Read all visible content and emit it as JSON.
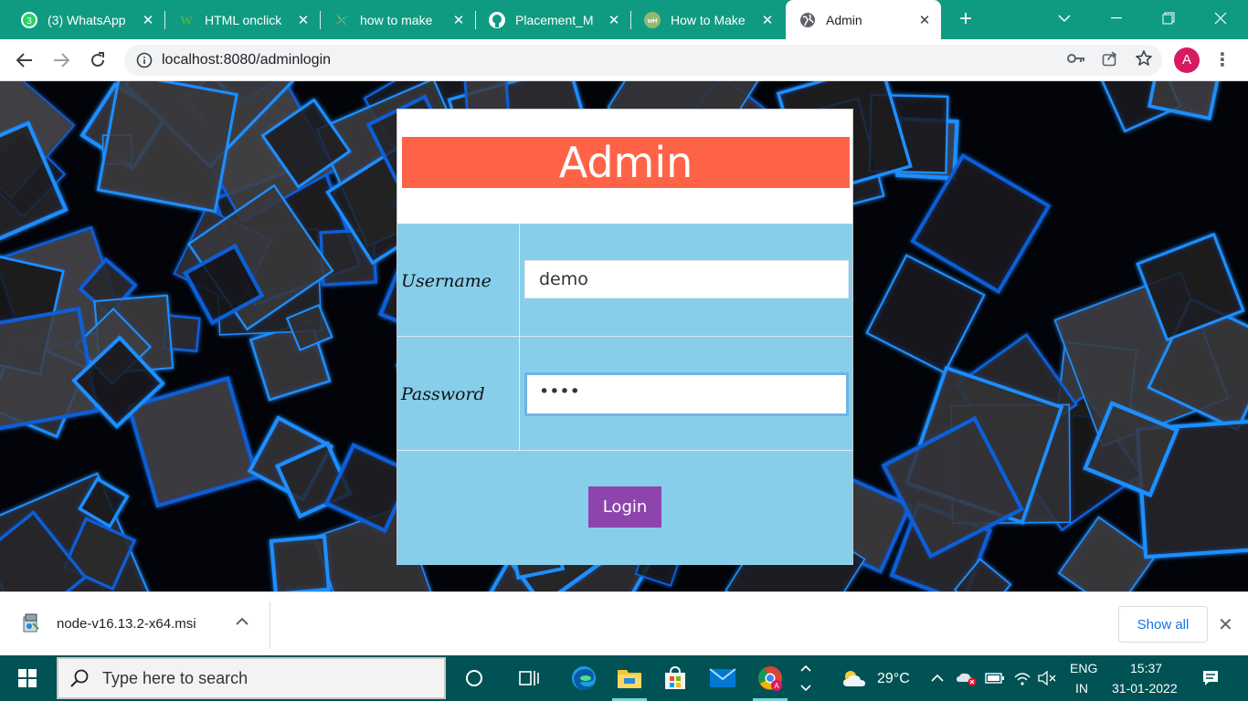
{
  "browser": {
    "tabs": [
      {
        "title": "(3) WhatsApp",
        "favicon": "whatsapp-icon",
        "active": false
      },
      {
        "title": "HTML onclick",
        "favicon": "w3-icon",
        "active": false
      },
      {
        "title": "how to make",
        "favicon": "pinwheel-icon",
        "active": false
      },
      {
        "title": "Placement_M",
        "favicon": "github-icon",
        "active": false
      },
      {
        "title": "How to Make",
        "favicon": "wikihow-icon",
        "active": false
      },
      {
        "title": "Admin",
        "favicon": "globe-icon",
        "active": true
      }
    ],
    "whatsapp_badge": "3",
    "url": "localhost:8080/adminlogin",
    "profile_initial": "A",
    "tab_strip_color": "#0e9b82"
  },
  "page": {
    "header": "Admin",
    "username_label": "Username",
    "username_value": "demo",
    "password_label": "Password",
    "password_value": "••••",
    "login_label": "Login",
    "colors": {
      "header_bg": "#ff6347",
      "form_bg": "#87ceeb",
      "button_bg": "#8e44ad"
    }
  },
  "downloads": {
    "file_name": "node-v16.13.2-x64.msi",
    "show_all_label": "Show all"
  },
  "taskbar": {
    "search_placeholder": "Type here to search",
    "temperature": "29°C",
    "language": "ENG",
    "region": "IN",
    "time": "15:37",
    "date": "31-01-2022"
  }
}
